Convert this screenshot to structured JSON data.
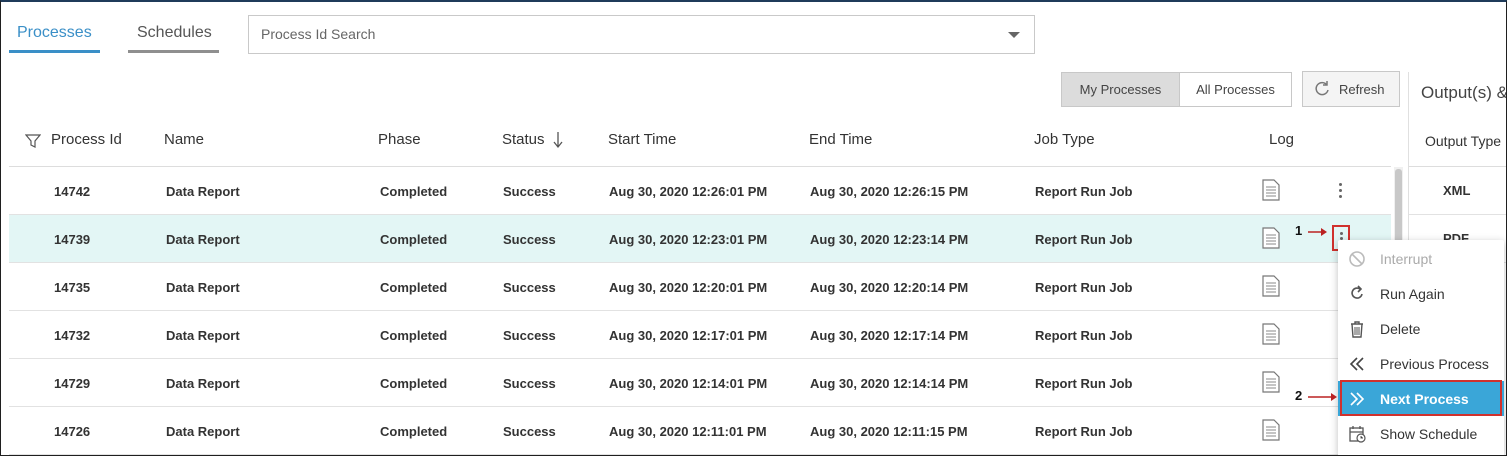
{
  "tabs": {
    "processes": "Processes",
    "schedules": "Schedules"
  },
  "search": {
    "placeholder": "Process Id Search"
  },
  "view_toggle": {
    "my": "My Processes",
    "all": "All Processes"
  },
  "refresh_label": "Refresh",
  "table": {
    "headers": {
      "process_id": "Process Id",
      "name": "Name",
      "phase": "Phase",
      "status": "Status",
      "start_time": "Start Time",
      "end_time": "End Time",
      "job_type": "Job Type",
      "log": "Log"
    },
    "rows": [
      {
        "id": "14742",
        "name": "Data Report",
        "phase": "Completed",
        "status": "Success",
        "start": "Aug 30, 2020 12:26:01 PM",
        "end": "Aug 30, 2020 12:26:15 PM",
        "job": "Report Run Job"
      },
      {
        "id": "14739",
        "name": "Data Report",
        "phase": "Completed",
        "status": "Success",
        "start": "Aug 30, 2020 12:23:01 PM",
        "end": "Aug 30, 2020 12:23:14 PM",
        "job": "Report Run Job"
      },
      {
        "id": "14735",
        "name": "Data Report",
        "phase": "Completed",
        "status": "Success",
        "start": "Aug 30, 2020 12:20:01 PM",
        "end": "Aug 30, 2020 12:20:14 PM",
        "job": "Report Run Job"
      },
      {
        "id": "14732",
        "name": "Data Report",
        "phase": "Completed",
        "status": "Success",
        "start": "Aug 30, 2020 12:17:01 PM",
        "end": "Aug 30, 2020 12:17:14 PM",
        "job": "Report Run Job"
      },
      {
        "id": "14729",
        "name": "Data Report",
        "phase": "Completed",
        "status": "Success",
        "start": "Aug 30, 2020 12:14:01 PM",
        "end": "Aug 30, 2020 12:14:14 PM",
        "job": "Report Run Job"
      },
      {
        "id": "14726",
        "name": "Data Report",
        "phase": "Completed",
        "status": "Success",
        "start": "Aug 30, 2020 12:11:01 PM",
        "end": "Aug 30, 2020 12:11:15 PM",
        "job": "Report Run Job"
      }
    ]
  },
  "outputs": {
    "title": "Output(s) &",
    "header": "Output Type",
    "rows": [
      "XML",
      "PDF"
    ]
  },
  "menu": {
    "items": [
      "Interrupt",
      "Run Again",
      "Delete",
      "Previous Process",
      "Next Process",
      "Show Schedule"
    ]
  },
  "annotations": {
    "one": "1",
    "two": "2"
  },
  "colors": {
    "accent": "#3a8fc7",
    "selected_row": "#e3f6f5",
    "menu_active": "#3aa6d8",
    "highlight_box": "#d0312d"
  }
}
